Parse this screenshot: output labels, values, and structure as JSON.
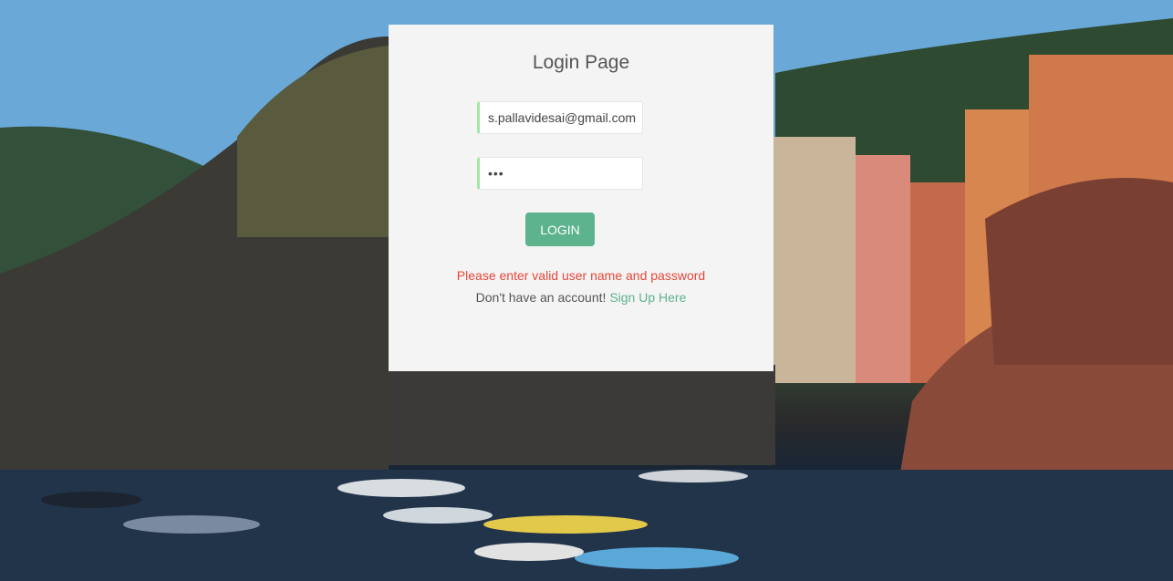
{
  "colors": {
    "accent": "#5cb38d",
    "error": "#e8463a",
    "field_accent": "#a2e6a8",
    "card_bg": "#f4f4f4"
  },
  "background": {
    "icon": "coastal-village-photo"
  },
  "login": {
    "title": "Login Page",
    "email_value": "s.pallavidesai@gmail.com",
    "password_value": "•••",
    "button_label": "LOGIN",
    "error_message": "Please enter valid user name and password",
    "signup_prompt": "Don't have an account!",
    "signup_link": "Sign Up Here"
  }
}
